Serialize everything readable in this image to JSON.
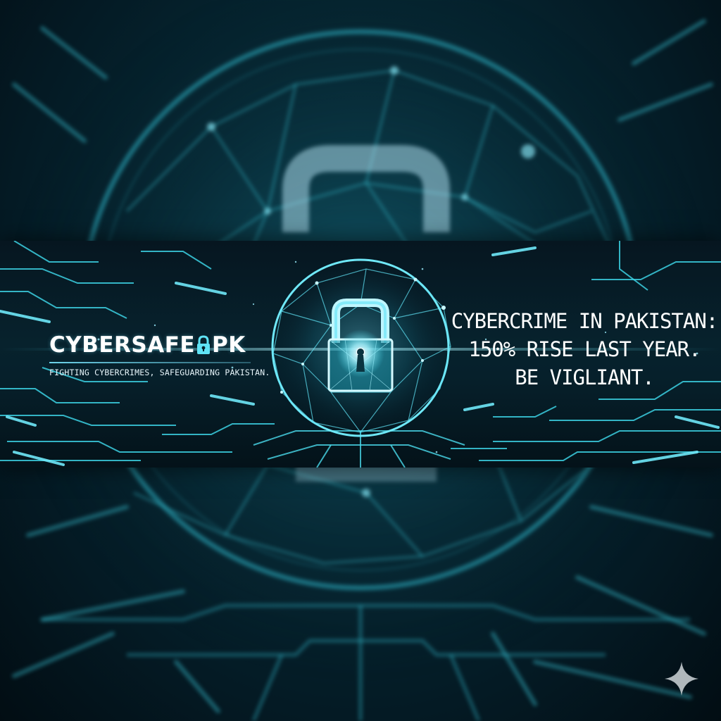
{
  "brand": {
    "name_left": "CYBERSAFE",
    "name_right": "PK",
    "lock_icon": "padlock-icon",
    "tagline": "FIGHTING CYBERCRIMES, SAFEGUARDING PAKISTAN."
  },
  "headline": {
    "line1": "CYBERCRIME IN PAKISTAN:",
    "line2": "150% RISE LAST YEAR.",
    "line3": "BE VIGLIANT."
  },
  "icons": {
    "center": "padlock-globe-icon",
    "corner": "sparkle-icon"
  },
  "colors": {
    "accent": "#5fe3f5",
    "background": "#041a24",
    "text": "#ffffff"
  }
}
